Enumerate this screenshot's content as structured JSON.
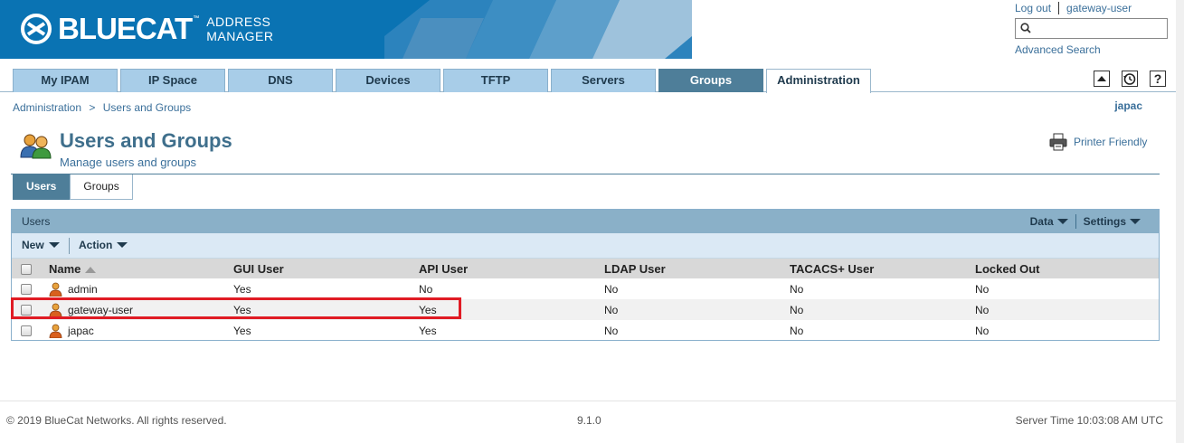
{
  "header": {
    "logo_text": "BLUECAT",
    "logo_tm": "™",
    "logo_sub_line1": "ADDRESS",
    "logo_sub_line2": "MANAGER",
    "logout_label": "Log out",
    "current_user": "gateway-user",
    "search": {
      "value": "",
      "placeholder": ""
    },
    "advanced_search_label": "Advanced Search",
    "brand_color": "#0a73b3"
  },
  "nav": {
    "tabs": [
      {
        "label": "My IPAM"
      },
      {
        "label": "IP Space"
      },
      {
        "label": "DNS"
      },
      {
        "label": "Devices"
      },
      {
        "label": "TFTP"
      },
      {
        "label": "Servers"
      },
      {
        "label": "Groups"
      },
      {
        "label": "Administration"
      }
    ],
    "right_buttons": [
      "collapse-icon",
      "history-icon",
      "help-icon"
    ]
  },
  "breadcrumb": {
    "items": [
      "Administration",
      ">",
      "Users and Groups"
    ]
  },
  "session_user": "japac",
  "page": {
    "title": "Users and Groups",
    "subtitle": "Manage users and groups",
    "printer_label": "Printer Friendly"
  },
  "subtabs": [
    {
      "label": "Users"
    },
    {
      "label": "Groups"
    }
  ],
  "panel": {
    "title": "Users",
    "data_label": "Data",
    "settings_label": "Settings",
    "new_label": "New",
    "action_label": "Action"
  },
  "table": {
    "columns": [
      "Name",
      "GUI User",
      "API User",
      "LDAP User",
      "TACACS+ User",
      "Locked Out"
    ],
    "rows": [
      {
        "name": "admin",
        "gui": "Yes",
        "api": "No",
        "ldap": "No",
        "tacacs": "No",
        "locked": "No"
      },
      {
        "name": "gateway-user",
        "gui": "Yes",
        "api": "Yes",
        "ldap": "No",
        "tacacs": "No",
        "locked": "No"
      },
      {
        "name": "japac",
        "gui": "Yes",
        "api": "Yes",
        "ldap": "No",
        "tacacs": "No",
        "locked": "No"
      }
    ],
    "highlight_color": "#e01b24"
  },
  "footer": {
    "copyright": "© 2019 BlueCat Networks. All rights reserved.",
    "version": "9.1.0",
    "server_time": "Server Time 10:03:08 AM UTC"
  }
}
